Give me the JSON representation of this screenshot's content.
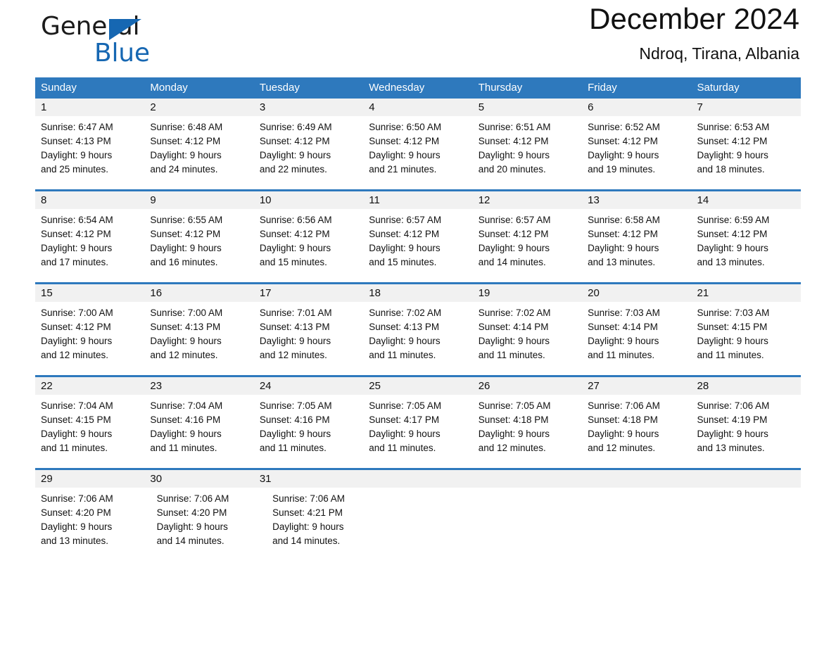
{
  "brand": {
    "name_part1": "General",
    "name_part2": "Blue",
    "logo_icon": "triangle-logo-icon",
    "accent_color": "#1667b2"
  },
  "header": {
    "month_title": "December 2024",
    "location": "Ndroq, Tirana, Albania"
  },
  "calendar": {
    "header_color": "#2e79bd",
    "daynum_band_color": "#f1f1f1",
    "weekdays": [
      "Sunday",
      "Monday",
      "Tuesday",
      "Wednesday",
      "Thursday",
      "Friday",
      "Saturday"
    ],
    "weeks": [
      [
        {
          "day": "1",
          "sunrise": "Sunrise: 6:47 AM",
          "sunset": "Sunset: 4:13 PM",
          "daylight_line1": "Daylight: 9 hours",
          "daylight_line2": "and 25 minutes."
        },
        {
          "day": "2",
          "sunrise": "Sunrise: 6:48 AM",
          "sunset": "Sunset: 4:12 PM",
          "daylight_line1": "Daylight: 9 hours",
          "daylight_line2": "and 24 minutes."
        },
        {
          "day": "3",
          "sunrise": "Sunrise: 6:49 AM",
          "sunset": "Sunset: 4:12 PM",
          "daylight_line1": "Daylight: 9 hours",
          "daylight_line2": "and 22 minutes."
        },
        {
          "day": "4",
          "sunrise": "Sunrise: 6:50 AM",
          "sunset": "Sunset: 4:12 PM",
          "daylight_line1": "Daylight: 9 hours",
          "daylight_line2": "and 21 minutes."
        },
        {
          "day": "5",
          "sunrise": "Sunrise: 6:51 AM",
          "sunset": "Sunset: 4:12 PM",
          "daylight_line1": "Daylight: 9 hours",
          "daylight_line2": "and 20 minutes."
        },
        {
          "day": "6",
          "sunrise": "Sunrise: 6:52 AM",
          "sunset": "Sunset: 4:12 PM",
          "daylight_line1": "Daylight: 9 hours",
          "daylight_line2": "and 19 minutes."
        },
        {
          "day": "7",
          "sunrise": "Sunrise: 6:53 AM",
          "sunset": "Sunset: 4:12 PM",
          "daylight_line1": "Daylight: 9 hours",
          "daylight_line2": "and 18 minutes."
        }
      ],
      [
        {
          "day": "8",
          "sunrise": "Sunrise: 6:54 AM",
          "sunset": "Sunset: 4:12 PM",
          "daylight_line1": "Daylight: 9 hours",
          "daylight_line2": "and 17 minutes."
        },
        {
          "day": "9",
          "sunrise": "Sunrise: 6:55 AM",
          "sunset": "Sunset: 4:12 PM",
          "daylight_line1": "Daylight: 9 hours",
          "daylight_line2": "and 16 minutes."
        },
        {
          "day": "10",
          "sunrise": "Sunrise: 6:56 AM",
          "sunset": "Sunset: 4:12 PM",
          "daylight_line1": "Daylight: 9 hours",
          "daylight_line2": "and 15 minutes."
        },
        {
          "day": "11",
          "sunrise": "Sunrise: 6:57 AM",
          "sunset": "Sunset: 4:12 PM",
          "daylight_line1": "Daylight: 9 hours",
          "daylight_line2": "and 15 minutes."
        },
        {
          "day": "12",
          "sunrise": "Sunrise: 6:57 AM",
          "sunset": "Sunset: 4:12 PM",
          "daylight_line1": "Daylight: 9 hours",
          "daylight_line2": "and 14 minutes."
        },
        {
          "day": "13",
          "sunrise": "Sunrise: 6:58 AM",
          "sunset": "Sunset: 4:12 PM",
          "daylight_line1": "Daylight: 9 hours",
          "daylight_line2": "and 13 minutes."
        },
        {
          "day": "14",
          "sunrise": "Sunrise: 6:59 AM",
          "sunset": "Sunset: 4:12 PM",
          "daylight_line1": "Daylight: 9 hours",
          "daylight_line2": "and 13 minutes."
        }
      ],
      [
        {
          "day": "15",
          "sunrise": "Sunrise: 7:00 AM",
          "sunset": "Sunset: 4:12 PM",
          "daylight_line1": "Daylight: 9 hours",
          "daylight_line2": "and 12 minutes."
        },
        {
          "day": "16",
          "sunrise": "Sunrise: 7:00 AM",
          "sunset": "Sunset: 4:13 PM",
          "daylight_line1": "Daylight: 9 hours",
          "daylight_line2": "and 12 minutes."
        },
        {
          "day": "17",
          "sunrise": "Sunrise: 7:01 AM",
          "sunset": "Sunset: 4:13 PM",
          "daylight_line1": "Daylight: 9 hours",
          "daylight_line2": "and 12 minutes."
        },
        {
          "day": "18",
          "sunrise": "Sunrise: 7:02 AM",
          "sunset": "Sunset: 4:13 PM",
          "daylight_line1": "Daylight: 9 hours",
          "daylight_line2": "and 11 minutes."
        },
        {
          "day": "19",
          "sunrise": "Sunrise: 7:02 AM",
          "sunset": "Sunset: 4:14 PM",
          "daylight_line1": "Daylight: 9 hours",
          "daylight_line2": "and 11 minutes."
        },
        {
          "day": "20",
          "sunrise": "Sunrise: 7:03 AM",
          "sunset": "Sunset: 4:14 PM",
          "daylight_line1": "Daylight: 9 hours",
          "daylight_line2": "and 11 minutes."
        },
        {
          "day": "21",
          "sunrise": "Sunrise: 7:03 AM",
          "sunset": "Sunset: 4:15 PM",
          "daylight_line1": "Daylight: 9 hours",
          "daylight_line2": "and 11 minutes."
        }
      ],
      [
        {
          "day": "22",
          "sunrise": "Sunrise: 7:04 AM",
          "sunset": "Sunset: 4:15 PM",
          "daylight_line1": "Daylight: 9 hours",
          "daylight_line2": "and 11 minutes."
        },
        {
          "day": "23",
          "sunrise": "Sunrise: 7:04 AM",
          "sunset": "Sunset: 4:16 PM",
          "daylight_line1": "Daylight: 9 hours",
          "daylight_line2": "and 11 minutes."
        },
        {
          "day": "24",
          "sunrise": "Sunrise: 7:05 AM",
          "sunset": "Sunset: 4:16 PM",
          "daylight_line1": "Daylight: 9 hours",
          "daylight_line2": "and 11 minutes."
        },
        {
          "day": "25",
          "sunrise": "Sunrise: 7:05 AM",
          "sunset": "Sunset: 4:17 PM",
          "daylight_line1": "Daylight: 9 hours",
          "daylight_line2": "and 11 minutes."
        },
        {
          "day": "26",
          "sunrise": "Sunrise: 7:05 AM",
          "sunset": "Sunset: 4:18 PM",
          "daylight_line1": "Daylight: 9 hours",
          "daylight_line2": "and 12 minutes."
        },
        {
          "day": "27",
          "sunrise": "Sunrise: 7:06 AM",
          "sunset": "Sunset: 4:18 PM",
          "daylight_line1": "Daylight: 9 hours",
          "daylight_line2": "and 12 minutes."
        },
        {
          "day": "28",
          "sunrise": "Sunrise: 7:06 AM",
          "sunset": "Sunset: 4:19 PM",
          "daylight_line1": "Daylight: 9 hours",
          "daylight_line2": "and 13 minutes."
        }
      ],
      [
        {
          "day": "29",
          "sunrise": "Sunrise: 7:06 AM",
          "sunset": "Sunset: 4:20 PM",
          "daylight_line1": "Daylight: 9 hours",
          "daylight_line2": "and 13 minutes."
        },
        {
          "day": "30",
          "sunrise": "Sunrise: 7:06 AM",
          "sunset": "Sunset: 4:20 PM",
          "daylight_line1": "Daylight: 9 hours",
          "daylight_line2": "and 14 minutes."
        },
        {
          "day": "31",
          "sunrise": "Sunrise: 7:06 AM",
          "sunset": "Sunset: 4:21 PM",
          "daylight_line1": "Daylight: 9 hours",
          "daylight_line2": "and 14 minutes."
        },
        {
          "day": "",
          "sunrise": "",
          "sunset": "",
          "daylight_line1": "",
          "daylight_line2": ""
        },
        {
          "day": "",
          "sunrise": "",
          "sunset": "",
          "daylight_line1": "",
          "daylight_line2": ""
        },
        {
          "day": "",
          "sunrise": "",
          "sunset": "",
          "daylight_line1": "",
          "daylight_line2": ""
        },
        {
          "day": "",
          "sunrise": "",
          "sunset": "",
          "daylight_line1": "",
          "daylight_line2": ""
        }
      ]
    ]
  }
}
